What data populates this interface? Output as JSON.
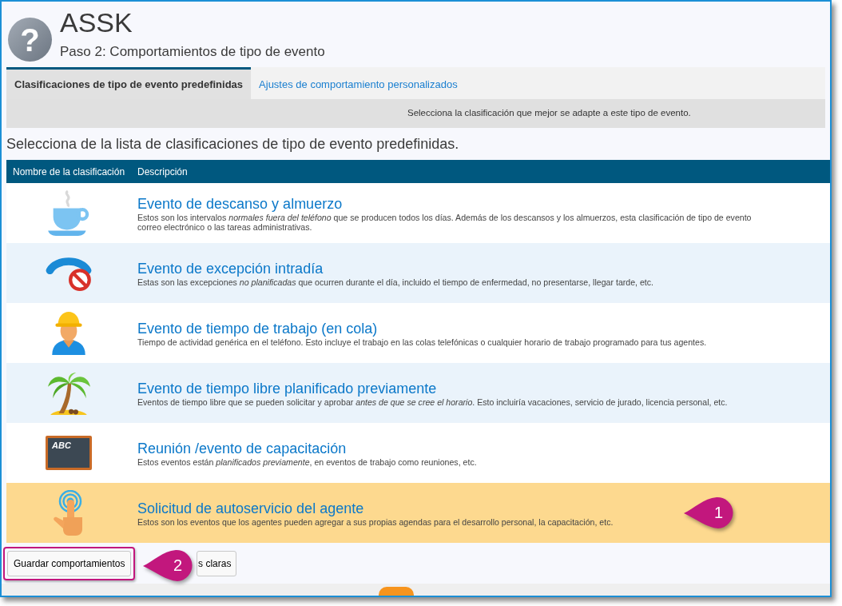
{
  "header": {
    "icon": "?",
    "title": "ASSK",
    "subtitle": "Paso 2: Comportamientos de tipo de evento"
  },
  "tabs": [
    {
      "label": "Clasificaciones de tipo de evento predefinidas",
      "selected": true
    },
    {
      "label": "Ajustes de comportamiento personalizados",
      "selected": false
    }
  ],
  "info_bar": "Selecciona la clasificación que mejor se adapte a este tipo de evento.",
  "instruction": "Selecciona de la lista de clasificaciones de tipo de evento predefinidas.",
  "table": {
    "columns": [
      "Nombre de la clasificación",
      "Descripción"
    ],
    "rows": [
      {
        "kind": "cup",
        "name": "Evento de descanso y almuerzo",
        "description": [
          "Estos son los intervalos *normales fuera del teléfono* que se producen todos los días. Además de los descansos y los almuerzos, esta clasificación de tipo de evento",
          "correo electrónico o las tareas administrativas."
        ],
        "selected": false
      },
      {
        "kind": "phone-blocked",
        "name": "Evento de excepción intradía",
        "description": [
          "Estas son las excepciones *no planificadas* que ocurren durante el día, incluido el tiempo de enfermedad, no presentarse, llegar tarde, etc."
        ],
        "selected": false
      },
      {
        "kind": "worker",
        "name": "Evento de tiempo de trabajo (en cola)",
        "description": [
          "Tiempo de actividad genérica en el teléfono. Esto incluye el trabajo en las colas telefónicas o cualquier horario de trabajo programado para tus agentes."
        ],
        "selected": false
      },
      {
        "kind": "palm",
        "name": "Evento de tiempo libre planificado previamente",
        "description": [
          "Eventos de tiempo libre que se pueden solicitar y aprobar *antes de que se cree el horario*. Esto incluiría vacaciones, servicio de jurado, licencia personal, etc."
        ],
        "selected": false
      },
      {
        "kind": "chalkboard",
        "icon_text": "ABC",
        "name": "Reunión /evento de capacitación",
        "description": [
          "Estos eventos están *planificados previamente*, en eventos de trabajo como reuniones, etc."
        ],
        "selected": false
      },
      {
        "kind": "touch",
        "name": "Solicitud de autoservicio del agente",
        "description": [
          "Estos son los eventos que los agentes pueden agregar a sus propias agendas para el desarrollo personal, la capacitación, etc."
        ],
        "selected": true,
        "callout": "1"
      }
    ]
  },
  "buttons": [
    {
      "label": "Guardar comportamientos",
      "highlighted": true,
      "callout": "2"
    },
    {
      "label": "s claras",
      "highlighted": false
    }
  ]
}
